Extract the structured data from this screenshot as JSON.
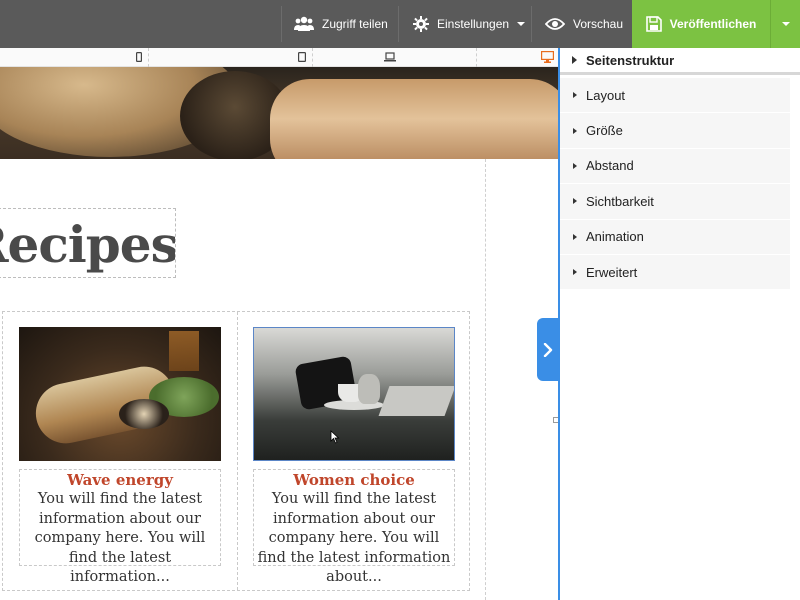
{
  "toolbar": {
    "share_label": "Zugriff teilen",
    "settings_label": "Einstellungen",
    "preview_label": "Vorschau",
    "publish_label": "Veröffentlichen",
    "accent_color": "#7cc242",
    "bg_color": "#5a5a5a"
  },
  "device_bar": {
    "icons": [
      "phone-icon",
      "tablet-icon",
      "laptop-icon",
      "desktop-icon"
    ],
    "active": "desktop-icon",
    "active_color": "#e86d1f"
  },
  "page": {
    "heading": "Recipes",
    "cards": [
      {
        "title": "Wave energy",
        "body": "You will find the latest information about our company here. You will find the latest information..."
      },
      {
        "title": "Women choice",
        "body": "You will find the latest information about our company here. You will find the latest information about..."
      }
    ],
    "title_color": "#c0462b"
  },
  "panel": {
    "title": "Seitenstruktur",
    "items": [
      {
        "label": "Layout"
      },
      {
        "label": "Größe"
      },
      {
        "label": "Abstand"
      },
      {
        "label": "Sichtbarkeit"
      },
      {
        "label": "Animation"
      },
      {
        "label": "Erweitert"
      }
    ],
    "toggle_color": "#3a8ee6"
  }
}
